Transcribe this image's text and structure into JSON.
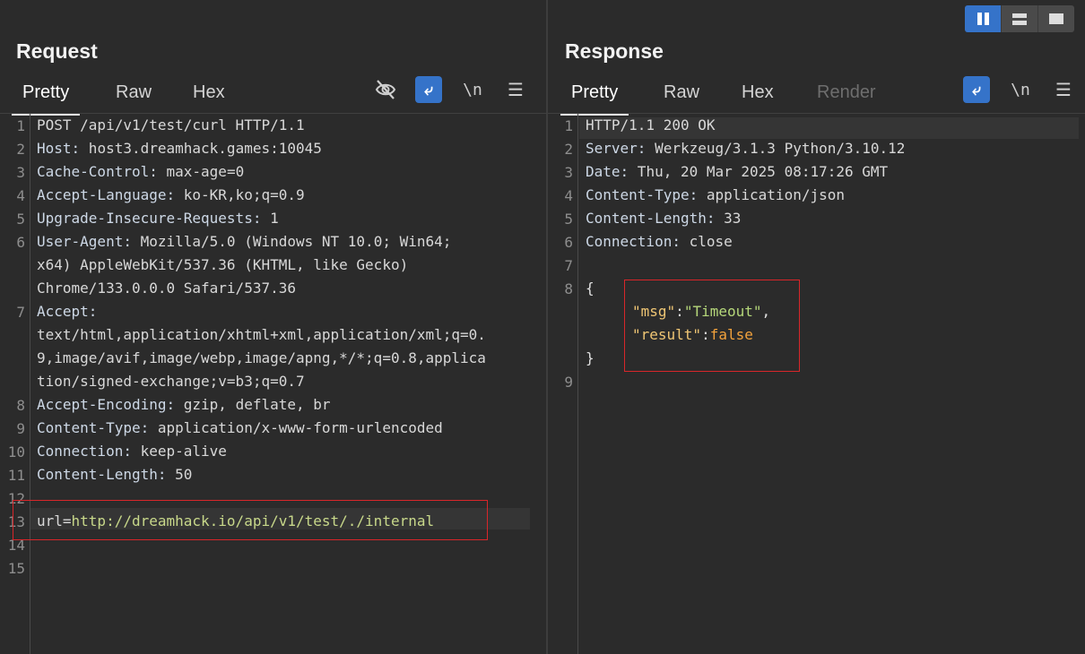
{
  "layout_buttons": [
    "split-horizontal",
    "split-vertical",
    "single"
  ],
  "request": {
    "title": "Request",
    "tabs": [
      "Pretty",
      "Raw",
      "Hex"
    ],
    "active_tab": "Pretty",
    "toolbar": {
      "hide_icon": "eye-slash-icon",
      "wrap_icon": "wrap-icon",
      "newline_label": "\\n",
      "menu_icon": "hamburger-icon"
    },
    "line_numbers": [
      "1",
      "2",
      "3",
      "4",
      "5",
      "6",
      "7",
      "8",
      "9",
      "10",
      "11",
      "12",
      "13",
      "14",
      "15"
    ],
    "lines": [
      {
        "text": "POST /api/v1/test/curl HTTP/1.1"
      },
      {
        "name": "Host",
        "value": " host3.dreamhack.games:10045"
      },
      {
        "name": "Cache-Control",
        "value": " max-age=0"
      },
      {
        "name": "Accept-Language",
        "value": " ko-KR,ko;q=0.9"
      },
      {
        "name": "Upgrade-Insecure-Requests",
        "value": " 1"
      },
      {
        "name": "User-Agent",
        "value": " Mozilla/5.0 (Windows NT 10.0; Win64;"
      },
      {
        "text": "x64) AppleWebKit/537.36 (KHTML, like Gecko)"
      },
      {
        "text": "Chrome/133.0.0.0 Safari/537.36"
      },
      {
        "name": "Accept",
        "value": ""
      },
      {
        "text": "text/html,application/xhtml+xml,application/xml;q=0."
      },
      {
        "text": "9,image/avif,image/webp,image/apng,*/*;q=0.8,applica"
      },
      {
        "text": "tion/signed-exchange;v=b3;q=0.7"
      },
      {
        "name": "Accept-Encoding",
        "value": " gzip, deflate, br"
      },
      {
        "name": "Content-Type",
        "value": " application/x-www-form-urlencoded"
      },
      {
        "name": "Connection",
        "value": " keep-alive"
      },
      {
        "name": "Content-Length",
        "value": " 50"
      },
      {
        "text": ""
      },
      {
        "param_key": "url=",
        "param_value": "http://dreamhack.io/api/v1/test/./internal"
      },
      {
        "text": ""
      },
      {
        "text": ""
      }
    ]
  },
  "response": {
    "title": "Response",
    "tabs": [
      "Pretty",
      "Raw",
      "Hex",
      "Render"
    ],
    "active_tab": "Pretty",
    "toolbar": {
      "wrap_icon": "wrap-icon",
      "newline_label": "\\n",
      "menu_icon": "hamburger-icon"
    },
    "line_numbers": [
      "1",
      "2",
      "3",
      "4",
      "5",
      "6",
      "7",
      "8",
      "9"
    ],
    "status_line": "HTTP/1.1 200 OK",
    "headers": [
      {
        "name": "Server",
        "value": " Werkzeug/3.1.3 Python/3.10.12"
      },
      {
        "name": "Date",
        "value": " Thu, 20 Mar 2025 08:17:26 GMT"
      },
      {
        "name": "Content-Type",
        "value": " application/json"
      },
      {
        "name": "Content-Length",
        "value": " 33"
      },
      {
        "name": "Connection",
        "value": " close"
      }
    ],
    "json": {
      "open": "{",
      "msg_key": "\"msg\"",
      "msg_value": "\"Timeout\"",
      "result_key": "\"result\"",
      "result_value": "false",
      "colon": ":",
      "comma": ",",
      "close": "}"
    }
  }
}
